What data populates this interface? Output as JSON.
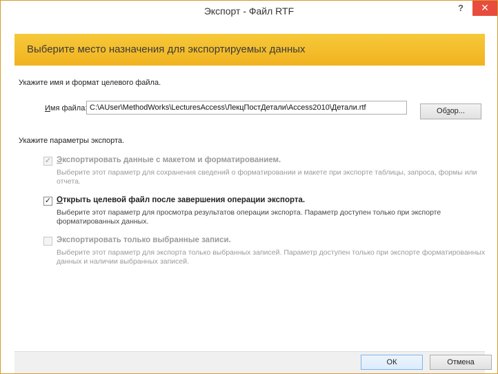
{
  "window": {
    "title": "Экспорт - Файл RTF",
    "help_glyph": "?",
    "close_glyph": "✕"
  },
  "banner": {
    "text": "Выберите место назначения для экспортируемых данных"
  },
  "file_section": {
    "heading": "Укажите имя и формат целевого файла.",
    "field_label_hotkey": "И",
    "field_label_rest": "мя файла:",
    "file_path": "C:\\AUser\\MethodWorks\\LecturesAccess\\ЛекцПостДетали\\Access2010\\Детали.rtf",
    "browse_hotkey_prefix": "Об",
    "browse_hotkey": "з",
    "browse_rest": "ор..."
  },
  "options_section": {
    "heading": "Укажите параметры экспорта.",
    "options": [
      {
        "label_hotkey": "Э",
        "label_rest": "кспортировать данные с макетом и форматированием.",
        "description": "Выберите этот параметр для сохранения сведений о форматировании и макете при экспорте таблицы, запроса, формы или отчета.",
        "checked": true,
        "enabled": false
      },
      {
        "label_hotkey": "О",
        "label_rest": "ткрыть целевой файл после завершения операции экспорта.",
        "description": "Выберите этот параметр для просмотра результатов операции экспорта. Параметр доступен только при экспорте форматированных данных.",
        "checked": true,
        "enabled": true
      },
      {
        "label_hotkey": "",
        "label_rest": "Экспортировать только выбранные записи.",
        "description": "Выберите этот параметр для экспорта только выбранных записей. Параметр доступен только при экспорте форматированных данных и наличии выбранных записей.",
        "checked": false,
        "enabled": false
      }
    ],
    "check_glyph": "✓"
  },
  "footer": {
    "ok_label": "ОК",
    "cancel_label": "Отмена"
  },
  "colors": {
    "banner": "#f1b21f",
    "close_button": "#e74c3c",
    "frame": "#d89a2a"
  }
}
